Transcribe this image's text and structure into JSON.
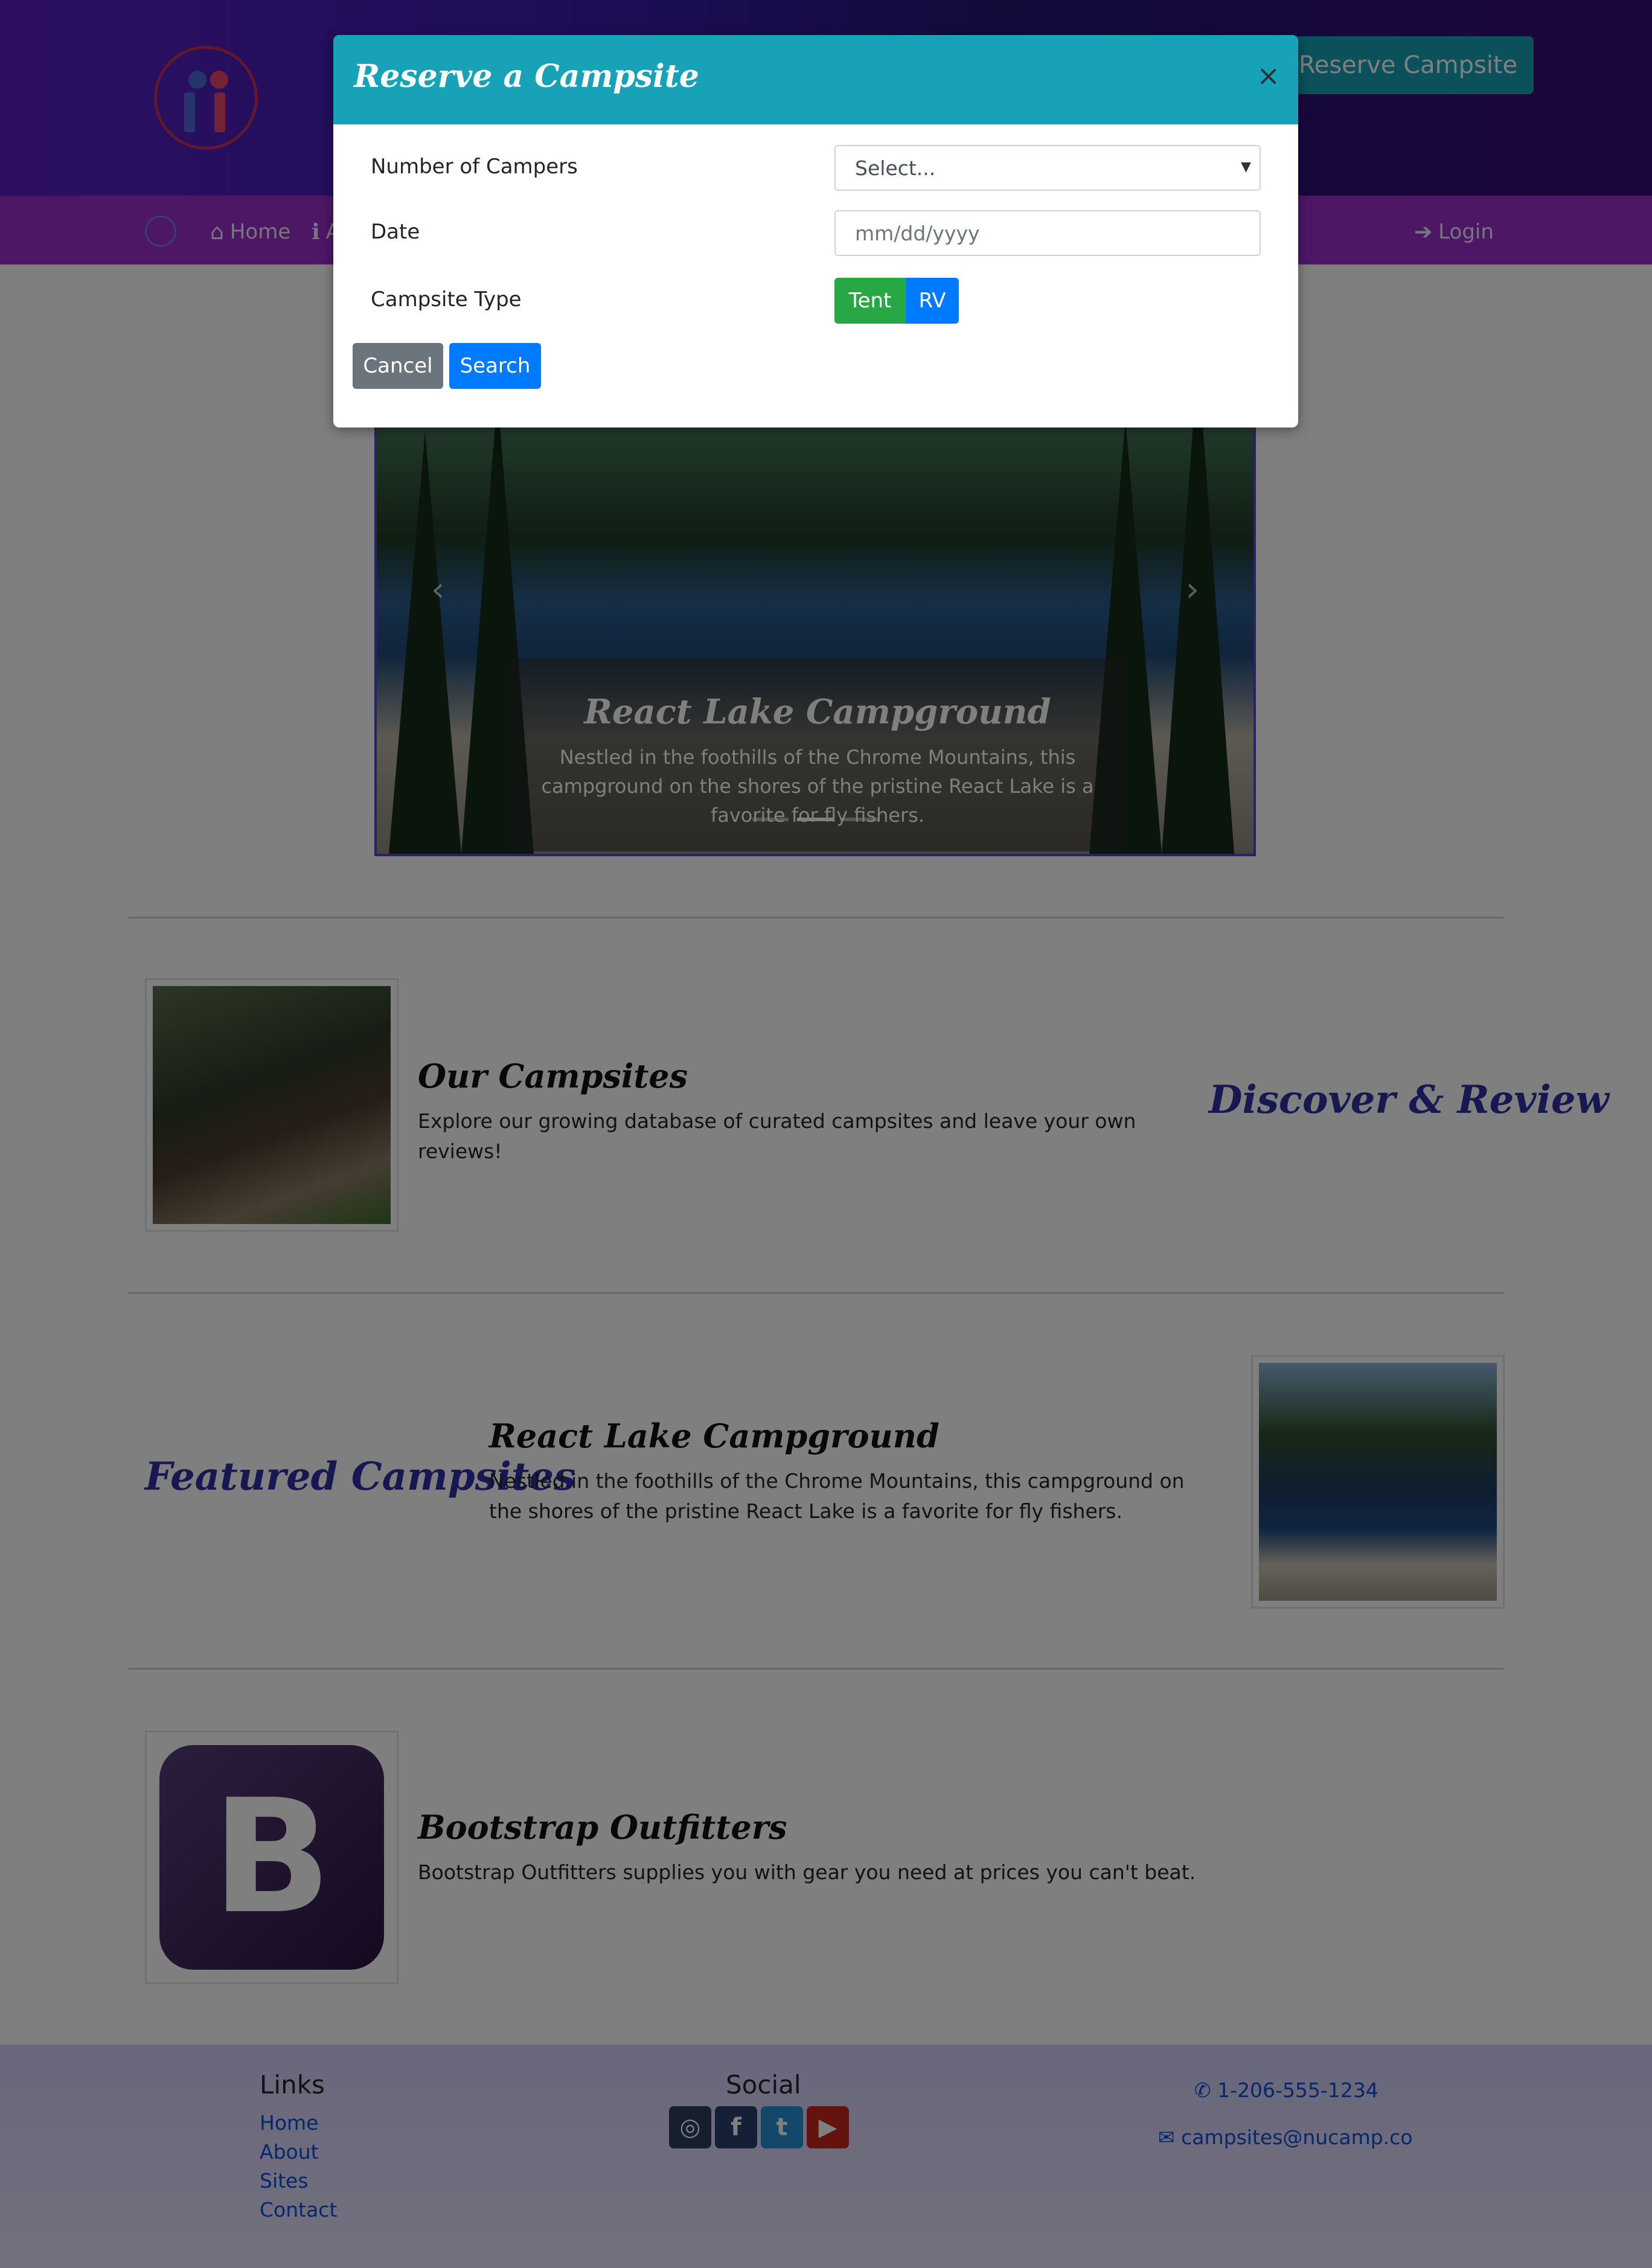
{
  "header": {
    "reserve_button": "Reserve Campsite"
  },
  "navbar": {
    "items": [
      {
        "label": "Home",
        "icon": "home-icon"
      },
      {
        "label": "A",
        "icon": "info-icon"
      },
      {
        "label": "Login",
        "icon": "sign-in-icon"
      }
    ]
  },
  "carousel": {
    "title": "React Lake Campground",
    "text": "Nestled in the foothills of the Chrome Mountains, this campground on the shores of the pristine React Lake is a favorite for fly fishers.",
    "indicators": 3,
    "active_index": 1
  },
  "sections": [
    {
      "title": "Our Campsites",
      "text": "Explore our growing database of curated campsites and leave your own reviews!",
      "side_title": "Discover & Review"
    },
    {
      "title": "React Lake Campground",
      "text": "Nestled in the foothills of the Chrome Mountains, this campground on the shores of the pristine React Lake is a favorite for fly fishers.",
      "side_title": "Featured Campsites"
    },
    {
      "title": "Bootstrap Outfitters",
      "text": "Bootstrap Outfitters supplies you with gear you need at prices you can't beat.",
      "logo_letter": "B"
    }
  ],
  "footer": {
    "links_title": "Links",
    "links": [
      "Home",
      "About",
      "Sites",
      "Contact"
    ],
    "social_title": "Social",
    "social_icons": [
      {
        "icon": "instagram-icon",
        "glyph": "◎",
        "color": "#2c3e5a"
      },
      {
        "icon": "facebook-icon",
        "glyph": "f",
        "color": "#2c3e70"
      },
      {
        "icon": "twitter-icon",
        "glyph": "t",
        "color": "#2a8fd6"
      },
      {
        "icon": "youtube-icon",
        "glyph": "▶",
        "color": "#c8271f"
      }
    ],
    "phone": "1-206-555-1234",
    "email": "campsites@nucamp.co"
  },
  "modal": {
    "title": "Reserve a Campsite",
    "close": "×",
    "fields": {
      "campers_label": "Number of Campers",
      "campers_value": "Select...",
      "date_label": "Date",
      "date_placeholder": "mm/dd/yyyy",
      "type_label": "Campsite Type",
      "type_options": [
        "Tent",
        "RV"
      ]
    },
    "cancel": "Cancel",
    "search": "Search"
  },
  "colors": {
    "teal": "#17a2b8",
    "primary": "#007bff",
    "success": "#28a745",
    "secondary": "#6c757d",
    "accent": "#2f2fa5"
  }
}
